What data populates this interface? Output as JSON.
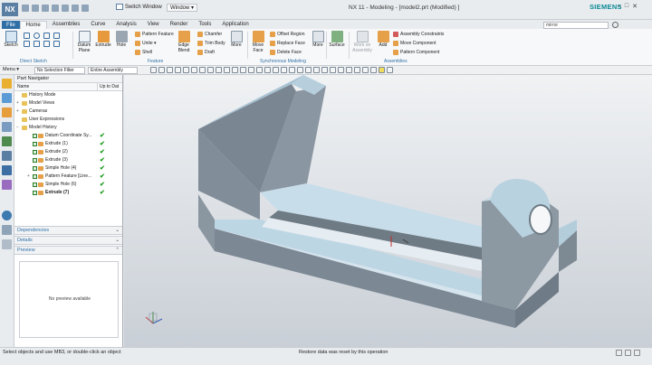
{
  "app": {
    "logo": "NX",
    "title": "NX 11 - Modeling - [model2.prt (Modified) ]",
    "brand": "SIEMENS",
    "switch_window": "Switch Window",
    "window_menu": "Window ▾"
  },
  "tabs": [
    "File",
    "Home",
    "Assemblies",
    "Curve",
    "Analysis",
    "View",
    "Render",
    "Tools",
    "Application"
  ],
  "active_tab": "Home",
  "search": {
    "value": "mirror"
  },
  "ribbon": {
    "sketch": {
      "label": "Sketch",
      "group": "Direct Sketch"
    },
    "feature": {
      "datum_plane": "Datum Plane",
      "extrude": "Extrude",
      "hole": "Hole",
      "pattern_feature": "Pattern Feature",
      "unite": "Unite ▾",
      "shell": "Shell",
      "edge_blend": "Edge Blend",
      "chamfer": "Chamfer",
      "trim_body": "Trim Body",
      "draft": "Draft",
      "more": "More",
      "group": "Feature"
    },
    "sync": {
      "move_face": "Move Face",
      "offset_region": "Offset Region",
      "replace_face": "Replace Face",
      "delete_face": "Delete Face",
      "more": "More",
      "group": "Synchronous Modeling"
    },
    "surface": {
      "label": "Surface"
    },
    "assemblies": {
      "work_on_assembly": "Work on Assembly",
      "add": "Add",
      "assembly_constraints": "Assembly Constraints",
      "move_component": "Move Component",
      "pattern_component": "Pattern Component",
      "group": "Assemblies"
    }
  },
  "toolbar": {
    "menu": "Menu ▾",
    "selection_filter": "No Selection Filter",
    "scope": "Entire Assembly"
  },
  "navigator": {
    "title": "Part Navigator",
    "col_name": "Name",
    "col_status": "Up to Dat",
    "items": [
      {
        "label": "History Mode",
        "indent": 0,
        "expander": "",
        "check": false,
        "ok": false
      },
      {
        "label": "Model Views",
        "indent": 0,
        "expander": "+",
        "check": false,
        "ok": false
      },
      {
        "label": "Cameras",
        "indent": 0,
        "expander": "+",
        "check": false,
        "ok": false
      },
      {
        "label": "User Expressions",
        "indent": 0,
        "expander": "",
        "check": false,
        "ok": false
      },
      {
        "label": "Model History",
        "indent": 0,
        "expander": "−",
        "check": false,
        "ok": false
      },
      {
        "label": "Datum Coordinate Sy...",
        "indent": 1,
        "expander": "",
        "check": true,
        "ok": true
      },
      {
        "label": "Extrude (1)",
        "indent": 1,
        "expander": "",
        "check": true,
        "ok": true
      },
      {
        "label": "Extrude (2)",
        "indent": 1,
        "expander": "",
        "check": true,
        "ok": true
      },
      {
        "label": "Extrude (3)",
        "indent": 1,
        "expander": "",
        "check": true,
        "ok": true
      },
      {
        "label": "Simple Hole (4)",
        "indent": 1,
        "expander": "",
        "check": true,
        "ok": true
      },
      {
        "label": "Pattern Feature [Line...",
        "indent": 1,
        "expander": "+",
        "check": true,
        "ok": true
      },
      {
        "label": "Simple Hole (6)",
        "indent": 1,
        "expander": "",
        "check": true,
        "ok": true
      },
      {
        "label": "Extrude (7)",
        "indent": 1,
        "expander": "",
        "check": true,
        "ok": true,
        "bold": true
      }
    ],
    "panels": {
      "dependencies": "Dependencies",
      "details": "Details",
      "preview": "Preview",
      "no_preview": "No preview available"
    }
  },
  "status": {
    "left": "Select objects and use MB3, or double-click an object",
    "mid": "Restore data was reset by this operation"
  },
  "colors": {
    "accent": "#2f6fa6",
    "model_top": "#bcd6e4",
    "model_side_dark": "#6f7c87",
    "model_side_mid": "#8e9aa4",
    "tick_green": "#1e9b1e"
  }
}
